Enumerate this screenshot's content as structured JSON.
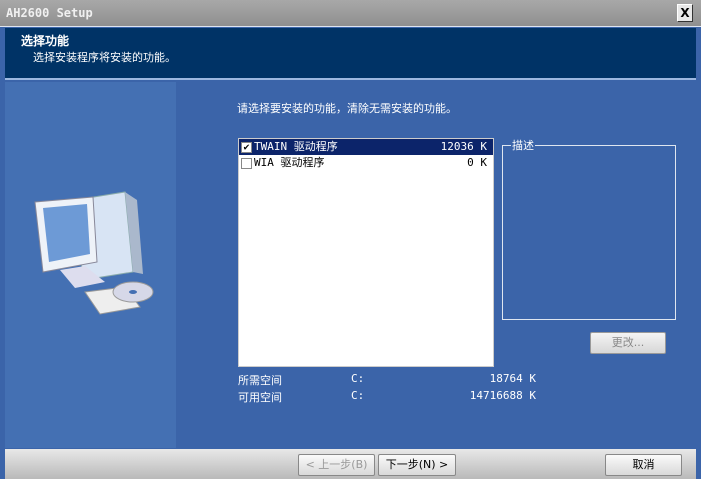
{
  "window": {
    "title": "AH2600 Setup",
    "close": "X"
  },
  "header": {
    "title": "选择功能",
    "subtitle": "选择安装程序将安装的功能。"
  },
  "main": {
    "prompt": "请选择要安装的功能，清除无需安装的功能。",
    "features": [
      {
        "name": "TWAIN 驱动程序",
        "size": "12036 K",
        "checked": true,
        "selected": true
      },
      {
        "name": "WIA 驱动程序",
        "size": "0 K",
        "checked": false,
        "selected": false
      }
    ],
    "description_label": "描述",
    "change_button": "更改...",
    "space": [
      {
        "label": "所需空间",
        "drive": "C:",
        "value": "18764 K"
      },
      {
        "label": "可用空间",
        "drive": "C:",
        "value": "14716688 K"
      }
    ]
  },
  "footer": {
    "back": "< 上一步(B)",
    "next": "下一步(N) >",
    "cancel": "取消"
  }
}
